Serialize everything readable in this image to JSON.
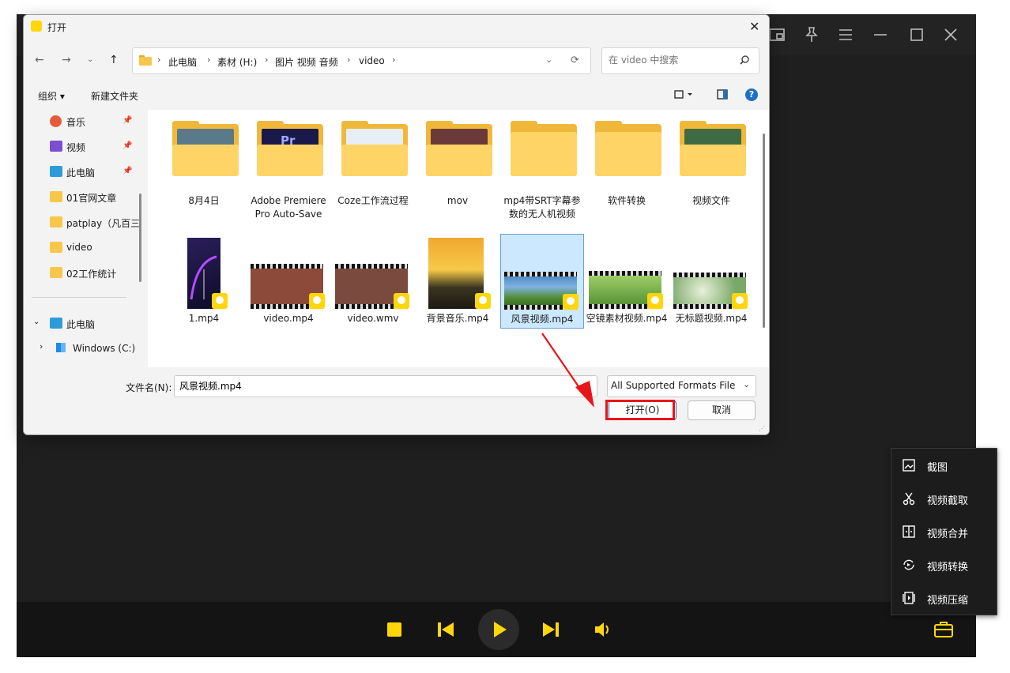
{
  "dialog": {
    "title": "打开",
    "close": "✕",
    "breadcrumbs": [
      "此电脑",
      "素材 (H:)",
      "图片 视频 音频",
      "video"
    ],
    "search_placeholder": "在 video 中搜索",
    "toolbar": {
      "organize": "组织 ▾",
      "new_folder": "新建文件夹",
      "help": "?"
    },
    "sidebar": {
      "quick": [
        {
          "label": "音乐",
          "icon": "music-icon"
        },
        {
          "label": "视频",
          "icon": "video-icon"
        },
        {
          "label": "此电脑",
          "icon": "computer-icon"
        },
        {
          "label": "01官网文章",
          "icon": "folder-icon"
        },
        {
          "label": "patplay（凡百三",
          "icon": "folder-icon"
        },
        {
          "label": "video",
          "icon": "folder-icon"
        },
        {
          "label": "02工作统计",
          "icon": "folder-icon"
        }
      ],
      "tree": [
        {
          "label": "此电脑",
          "icon": "computer-icon"
        },
        {
          "label": "Windows (C:)",
          "icon": "drive-icon"
        }
      ]
    },
    "files_row1": [
      {
        "label": "8月4日",
        "type": "folder",
        "paper": "#5a7a8a"
      },
      {
        "label": "Adobe Premiere Pro Auto-Save",
        "type": "folder-pr",
        "paper": "#1a1a4a"
      },
      {
        "label": "Coze工作流过程",
        "type": "folder",
        "paper": "#e8eef5"
      },
      {
        "label": "mov",
        "type": "folder",
        "paper": "#6a3a3a"
      },
      {
        "label": "mp4带SRT字幕参数的无人机视频",
        "type": "folder-empty",
        "paper": "#ffd466"
      },
      {
        "label": "软件转换",
        "type": "folder-empty",
        "paper": "#ffd466"
      },
      {
        "label": "视频文件",
        "type": "folder",
        "paper": "#3f6b44"
      }
    ],
    "files_row2": [
      {
        "label": "1.mp4",
        "kind": "phone"
      },
      {
        "label": "video.mp4",
        "kind": "film",
        "color": "#8b4a3a"
      },
      {
        "label": "video.wmv",
        "kind": "film",
        "color": "#7a4a3e"
      },
      {
        "label": "背景音乐.mp4",
        "kind": "photo"
      },
      {
        "label": "风景视频.mp4",
        "kind": "film",
        "color": "#3d7ab8",
        "selected": true
      },
      {
        "label": "空镜素材视频.mp4",
        "kind": "film",
        "color": "#4e8a2e"
      },
      {
        "label": "无标题视频.mp4",
        "kind": "film",
        "color": "#7aa86a"
      }
    ],
    "filename_label": "文件名(N):",
    "filename_value": "风景视频.mp4",
    "filetype": "All Supported Formats File (*",
    "open_button": "打开(O)",
    "cancel_button": "取消"
  },
  "tools_menu": [
    {
      "label": "截图",
      "icon": "screenshot-icon"
    },
    {
      "label": "视频截取",
      "icon": "scissors-icon"
    },
    {
      "label": "视频合并",
      "icon": "merge-icon"
    },
    {
      "label": "视频转换",
      "icon": "convert-icon"
    },
    {
      "label": "视频压缩",
      "icon": "compress-icon"
    }
  ],
  "colors": {
    "accent": "#ffd60a",
    "player_bg": "#1f1f1f",
    "highlight": "#e8151b"
  }
}
